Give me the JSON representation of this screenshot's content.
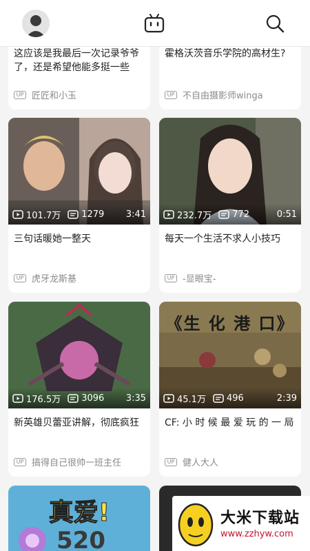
{
  "header": {
    "avatar_icon": "user-avatar",
    "center_icon": "tv-icon",
    "right_icon": "search-icon"
  },
  "cards": [
    {
      "title": "这应该是我最后一次记录爷爷了，还是希望他能多挺一些时…",
      "author": "匠匠和小玉"
    },
    {
      "title": "霍格沃茨音乐学院的高材生?",
      "author": "不自由摄影师winga"
    },
    {
      "views": "101.7万",
      "danmaku": "1279",
      "duration": "3:41",
      "title": "三句话暖她一整天",
      "author": "虎牙龙斯基"
    },
    {
      "views": "232.7万",
      "danmaku": "772",
      "duration": "0:51",
      "title": "每天一个生活不求人小技巧",
      "author": "-显眼宝-"
    },
    {
      "views": "176.5万",
      "danmaku": "3096",
      "duration": "3:35",
      "title": "新英雄贝蕾亚讲解，彻底疯狂",
      "author": "搞得自己很帅一班主任"
    },
    {
      "views": "45.1万",
      "danmaku": "496",
      "duration": "2:39",
      "title": "CF: 小 时 候 最 爱 玩 的 一 局",
      "author": "健人大人",
      "thumb_text": "《生 化 港 口》"
    },
    {
      "thumb_text": "真爱!",
      "thumb_number": "520"
    },
    {}
  ],
  "watermark": {
    "name": "大米下载站",
    "url": "www.zzhyw.com"
  },
  "up_badge": "UP",
  "colors": {
    "accent": "#fb7299",
    "watermark_red": "#c0152f"
  }
}
